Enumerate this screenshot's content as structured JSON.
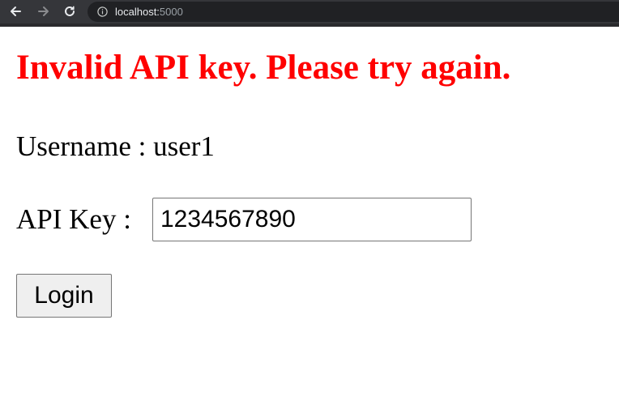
{
  "browser": {
    "url_host": "localhost:",
    "url_port": "5000",
    "icons": {
      "back": "arrow-left-icon",
      "forward": "arrow-right-icon",
      "reload": "reload-icon",
      "site_info": "info-icon"
    }
  },
  "page": {
    "error_message": "Invalid API key. Please try again.",
    "username_label": "Username : ",
    "username_value": "user1",
    "api_key_label": "API Key : ",
    "api_key_value": "1234567890",
    "login_button_label": "Login"
  },
  "colors": {
    "error": "#ff0000",
    "browser_bar": "#35363a",
    "omnibox": "#202124"
  }
}
